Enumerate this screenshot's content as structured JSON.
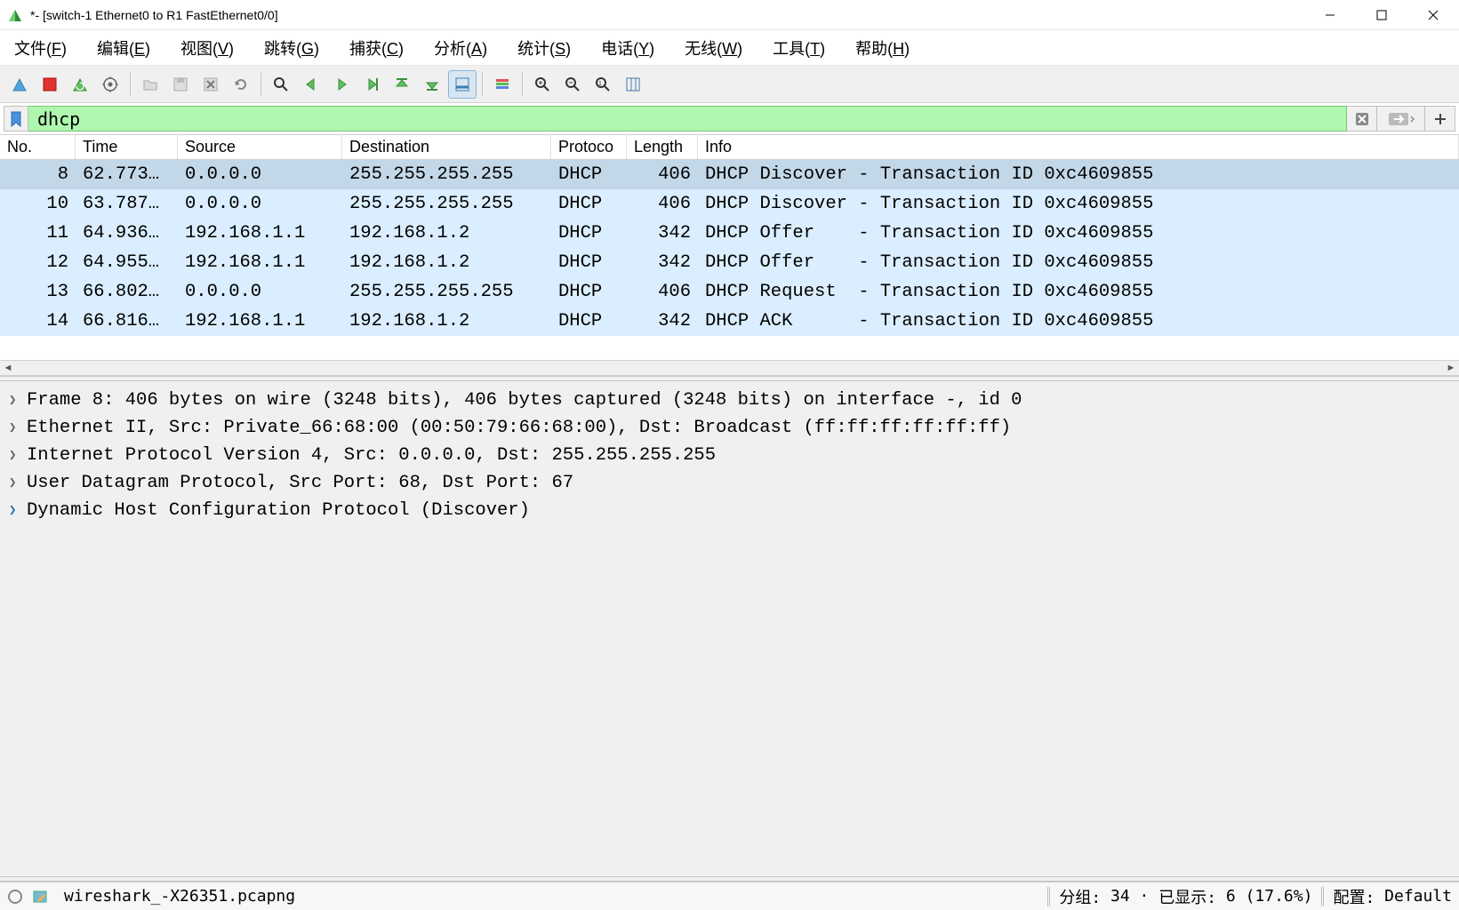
{
  "window": {
    "title": "*- [switch-1 Ethernet0 to R1 FastEthernet0/0]"
  },
  "menu": {
    "file": "文件(F)",
    "edit": "编辑(E)",
    "view": "视图(V)",
    "goto": "跳转(G)",
    "capture": "捕获(C)",
    "analyze": "分析(A)",
    "stats": "统计(S)",
    "tel": "电话(Y)",
    "wireless": "无线(W)",
    "tools": "工具(T)",
    "help": "帮助(H)"
  },
  "filter": {
    "value": "dhcp"
  },
  "columns": {
    "no": "No.",
    "time": "Time",
    "source": "Source",
    "dest": "Destination",
    "proto": "Protoco",
    "length": "Length",
    "info": "Info"
  },
  "packets": [
    {
      "no": "8",
      "time": "62.773…",
      "src": "0.0.0.0",
      "dst": "255.255.255.255",
      "proto": "DHCP",
      "len": "406",
      "info": "DHCP Discover - Transaction ID 0xc4609855",
      "sel": true
    },
    {
      "no": "10",
      "time": "63.787…",
      "src": "0.0.0.0",
      "dst": "255.255.255.255",
      "proto": "DHCP",
      "len": "406",
      "info": "DHCP Discover - Transaction ID 0xc4609855"
    },
    {
      "no": "11",
      "time": "64.936…",
      "src": "192.168.1.1",
      "dst": "192.168.1.2",
      "proto": "DHCP",
      "len": "342",
      "info": "DHCP Offer    - Transaction ID 0xc4609855"
    },
    {
      "no": "12",
      "time": "64.955…",
      "src": "192.168.1.1",
      "dst": "192.168.1.2",
      "proto": "DHCP",
      "len": "342",
      "info": "DHCP Offer    - Transaction ID 0xc4609855"
    },
    {
      "no": "13",
      "time": "66.802…",
      "src": "0.0.0.0",
      "dst": "255.255.255.255",
      "proto": "DHCP",
      "len": "406",
      "info": "DHCP Request  - Transaction ID 0xc4609855"
    },
    {
      "no": "14",
      "time": "66.816…",
      "src": "192.168.1.1",
      "dst": "192.168.1.2",
      "proto": "DHCP",
      "len": "342",
      "info": "DHCP ACK      - Transaction ID 0xc4609855"
    }
  ],
  "details": [
    {
      "text": "Frame 8: 406 bytes on wire (3248 bits), 406 bytes captured (3248 bits) on interface -, id 0"
    },
    {
      "text": "Ethernet II, Src: Private_66:68:00 (00:50:79:66:68:00), Dst: Broadcast (ff:ff:ff:ff:ff:ff)"
    },
    {
      "text": "Internet Protocol Version 4, Src: 0.0.0.0, Dst: 255.255.255.255"
    },
    {
      "text": "User Datagram Protocol, Src Port: 68, Dst Port: 67"
    },
    {
      "text": "Dynamic Host Configuration Protocol (Discover)",
      "current": true
    }
  ],
  "status": {
    "file": "wireshark_-X26351.pcapng",
    "packets_label": "分组:",
    "packets": "34",
    "displayed_label": "已显示:",
    "displayed": "6 (17.6%)",
    "profile_label": "配置:",
    "profile": "Default"
  }
}
